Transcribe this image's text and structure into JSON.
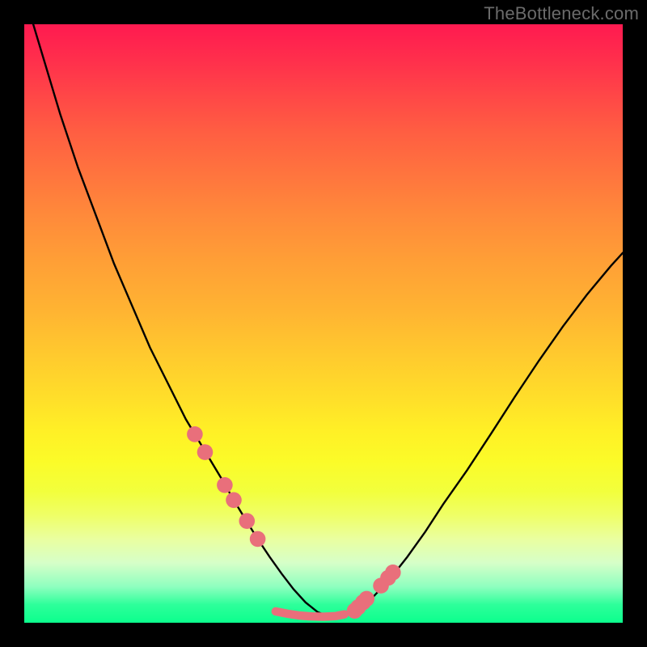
{
  "watermark": "TheBottleneck.com",
  "colors": {
    "curve": "#000000",
    "marker_fill": "#e96f7b",
    "marker_stroke": "#c94d5a",
    "background_black": "#000000"
  },
  "chart_data": {
    "type": "line",
    "title": "",
    "xlabel": "",
    "ylabel": "",
    "xlim": [
      0,
      100
    ],
    "ylim": [
      0,
      100
    ],
    "curve": {
      "x": [
        0,
        3,
        6,
        9,
        12,
        15,
        18,
        21,
        24,
        27,
        30,
        33,
        35,
        37,
        39,
        41,
        43,
        45,
        47,
        49,
        51,
        53,
        55,
        58,
        61,
        64,
        67,
        70,
        74,
        78,
        82,
        86,
        90,
        94,
        98,
        100
      ],
      "y": [
        105,
        95,
        85,
        76,
        68,
        60,
        53,
        46,
        40,
        34,
        29,
        24,
        20.5,
        17.2,
        14,
        11,
        8.2,
        5.6,
        3.4,
        1.8,
        1.0,
        1.1,
        1.9,
        4.0,
        7.2,
        11.0,
        15.2,
        19.8,
        25.5,
        31.6,
        37.8,
        43.8,
        49.5,
        54.8,
        59.6,
        61.8
      ]
    },
    "markers_left": {
      "x": [
        28.5,
        30.2,
        33.5,
        35.0,
        37.2,
        39.0
      ],
      "y": [
        31.5,
        28.5,
        23.0,
        20.5,
        17.0,
        14.0
      ]
    },
    "markers_right": {
      "x": [
        55.2,
        55.8,
        56.6,
        57.2,
        59.6,
        60.8,
        61.6
      ],
      "y": [
        2.0,
        2.6,
        3.4,
        4.0,
        6.2,
        7.5,
        8.4
      ]
    },
    "valley_band": {
      "x": [
        42.0,
        44.0,
        46.0,
        48.0,
        50.0,
        52.0,
        53.5
      ],
      "y": [
        1.9,
        1.5,
        1.2,
        1.05,
        1.0,
        1.1,
        1.4
      ]
    },
    "marker_radius": 9.8,
    "valley_half_thickness": 5.2
  }
}
